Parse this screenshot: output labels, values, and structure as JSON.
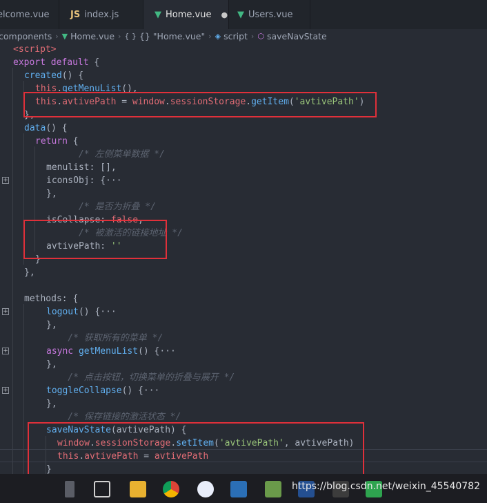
{
  "tabs": [
    {
      "label": "elcome.vue",
      "icon": "vue-icon"
    },
    {
      "label": "index.js",
      "icon": "js-icon",
      "badge": "JS"
    },
    {
      "label": "Home.vue",
      "icon": "vue-icon",
      "active": true,
      "modified": "●"
    },
    {
      "label": "Users.vue",
      "icon": "vue-icon"
    }
  ],
  "breadcrumb": {
    "items": [
      "components",
      "Home.vue",
      "{} \"Home.vue\"",
      "script",
      "saveNavState"
    ],
    "separator": "›"
  },
  "code": {
    "lines": [
      "<script>",
      "export default {",
      "  created() {",
      "    this.getMenuList(),",
      "    this.avtivePath = window.sessionStorage.getItem('avtivePath')",
      "  },",
      "  data() {",
      "    return {",
      "      /* 左侧菜单数据 */",
      "      menulist: [],",
      "      iconsObj: {···",
      "      },",
      "      /* 是否为折叠 */",
      "      isCollapse: false,",
      "      /* 被激活的链接地址 */",
      "      avtivePath: ''",
      "    }",
      "  },",
      "",
      "  methods: {",
      "    logout() {···",
      "    },",
      "    /* 获取所有的菜单 */",
      "    async getMenuList() {···",
      "    },",
      "    /* 点击按钮，切换菜单的折叠与展开 */",
      "    toggleCollapse() {···",
      "    },",
      "    /* 保存链接的激活状态 */",
      "    saveNavState(avtivePath) {",
      "      window.sessionStorage.setItem('avtivePath', avtivePath)",
      "      this.avtivePath = avtivePath",
      "    }"
    ]
  },
  "watermark": "https://blog.csdn.net/weixin_45540782",
  "colors": {
    "background": "#282c34",
    "keyword": "#c678dd",
    "function": "#61afef",
    "this": "#e06c75",
    "string": "#98c379",
    "comment": "#5c6370",
    "highlight_box": "#e0303a"
  },
  "taskbar_icons": [
    "search-icon",
    "task-view-icon",
    "file-explorer-icon",
    "chrome-icon",
    "app-icon",
    "app-icon-2",
    "app-icon-3",
    "powershell-icon",
    "terminal-icon",
    "hbuilder-icon"
  ]
}
